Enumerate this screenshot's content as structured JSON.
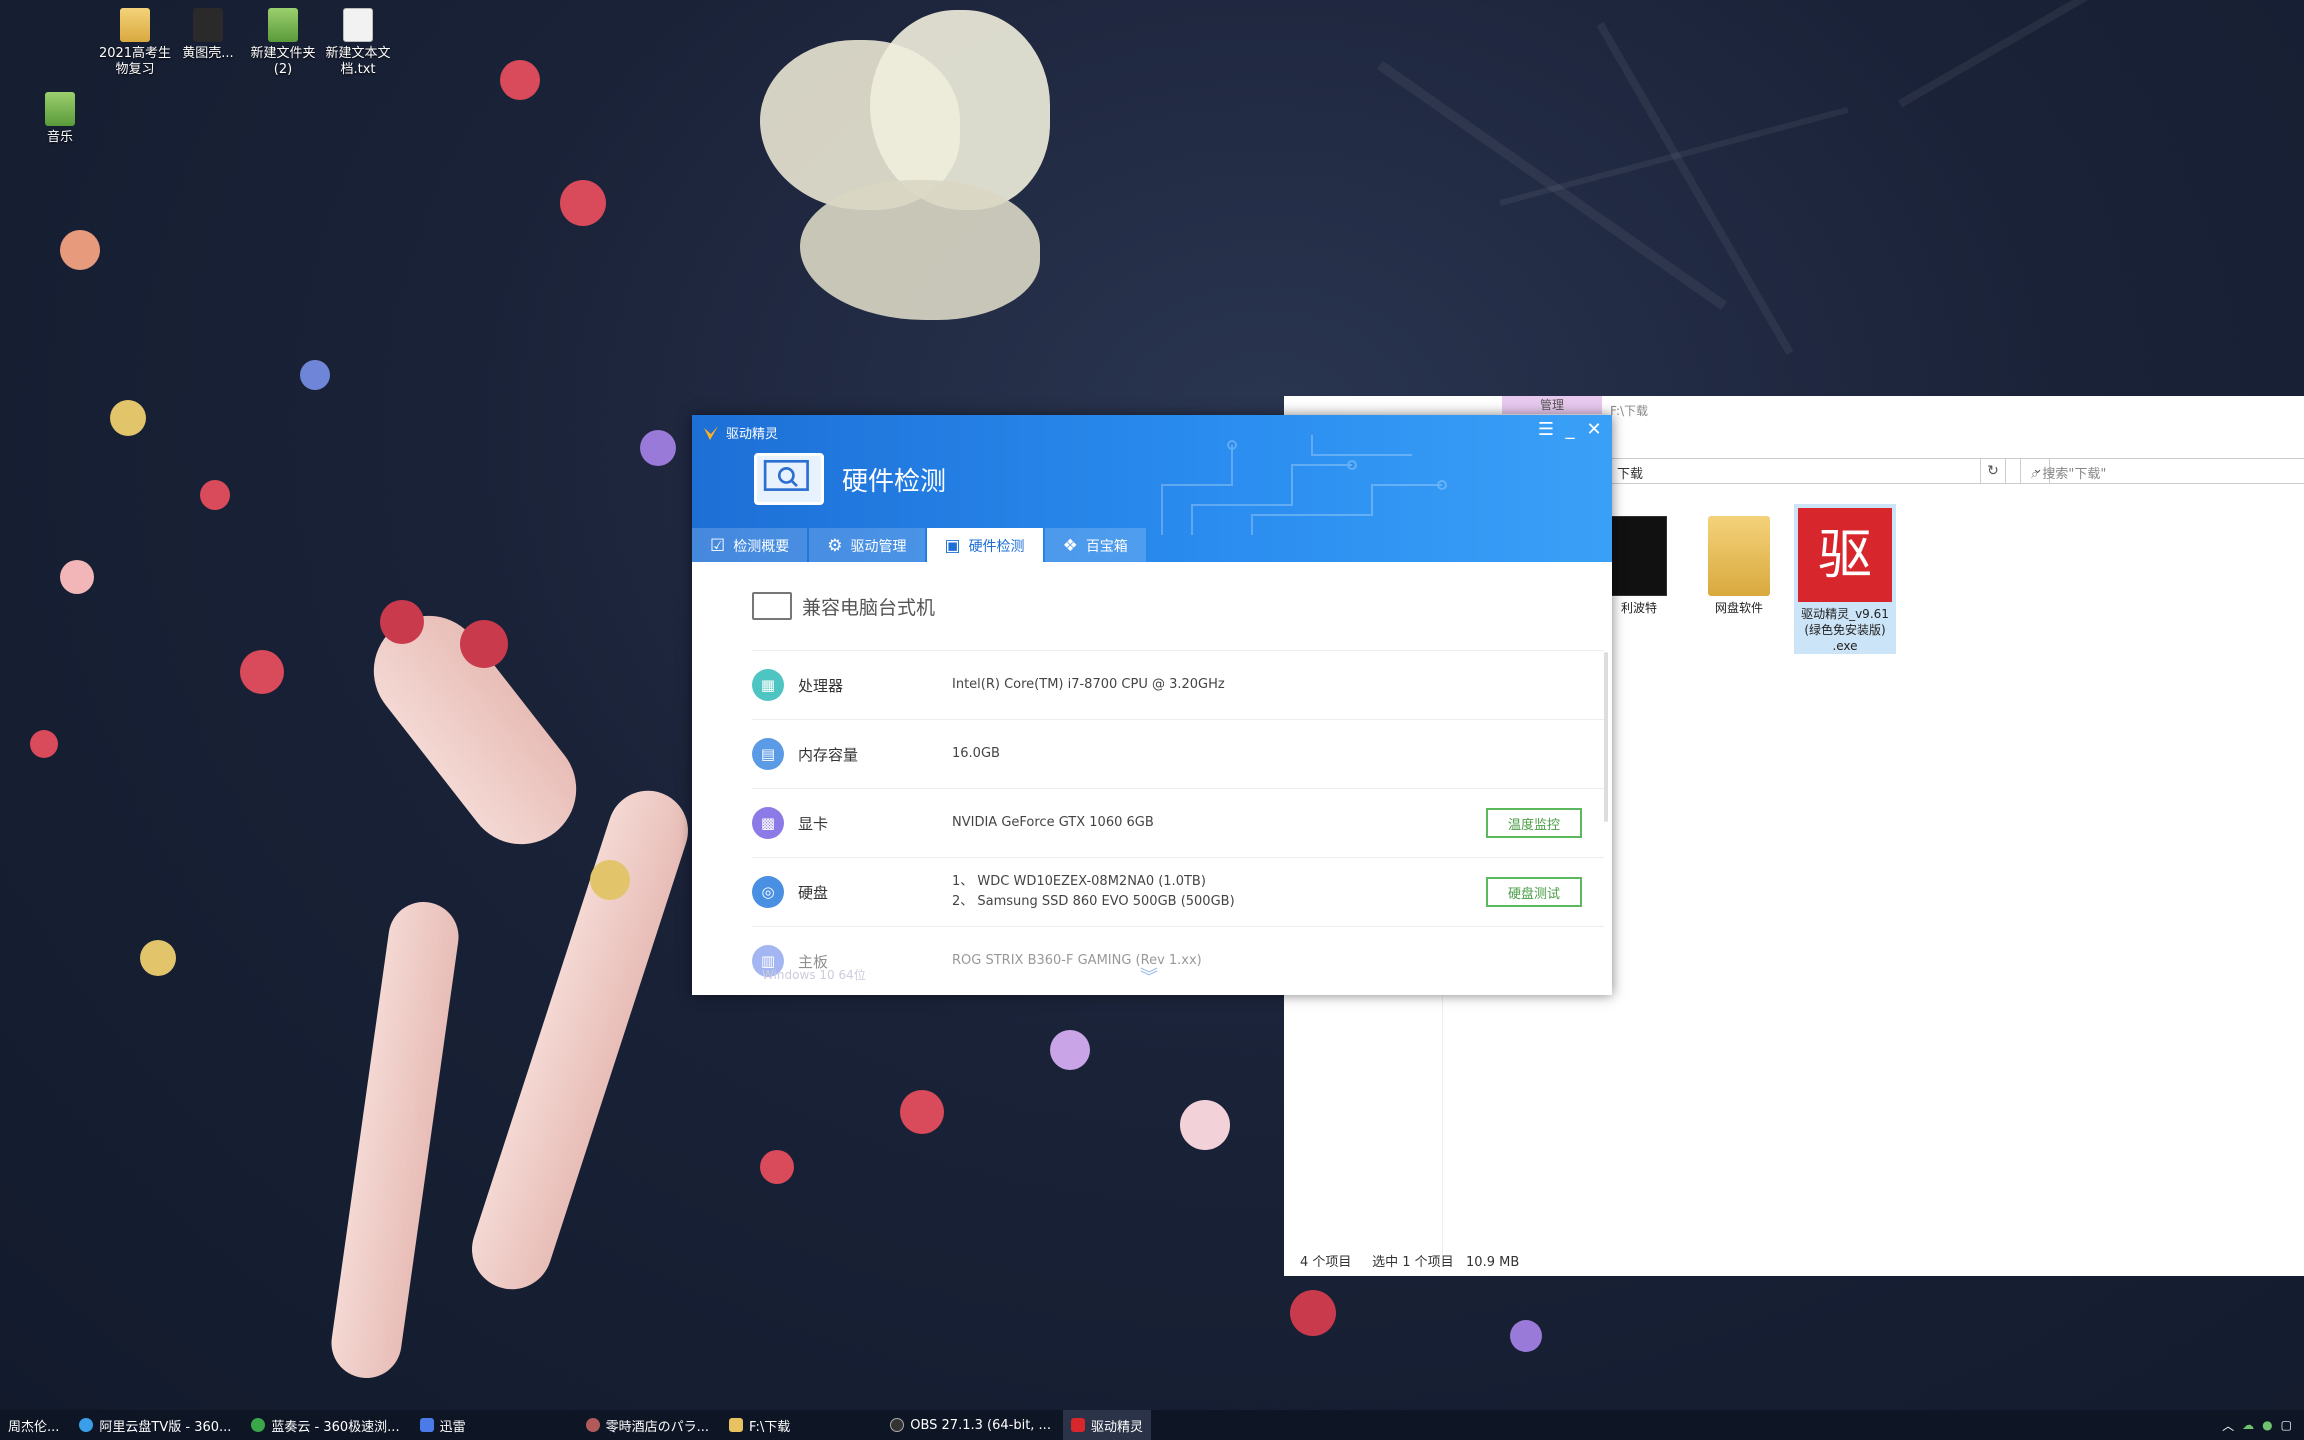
{
  "desktop": {
    "icons": [
      {
        "label": "2021高考生物复习"
      },
      {
        "label": "黄图壳..."
      },
      {
        "label": "新建文件夹 (2)"
      },
      {
        "label": "新建文本文档.txt"
      },
      {
        "label": "音乐"
      }
    ]
  },
  "explorer": {
    "manage_tab": "管理",
    "path_title": "F:\\下载",
    "address": "下载",
    "search_placeholder": "搜索\"下载\"",
    "files": [
      {
        "label": "利波特"
      },
      {
        "label": "网盘软件"
      },
      {
        "label": "驱动精灵_v9.61 (绿色免安装版) .exe"
      }
    ],
    "status": {
      "item_count": "4 个项目",
      "selected": "选中 1 个项目",
      "size": "10.9 MB"
    }
  },
  "app": {
    "name": "驱动精灵",
    "header_title": "硬件检测",
    "tabs": [
      {
        "label": "检测概要",
        "icon": "check-icon"
      },
      {
        "label": "驱动管理",
        "icon": "gear-icon"
      },
      {
        "label": "硬件检测",
        "icon": "monitor-icon"
      },
      {
        "label": "百宝箱",
        "icon": "toolbox-icon"
      }
    ],
    "pc_type": "兼容电脑台式机",
    "rows": [
      {
        "label": "处理器",
        "value": "Intel(R) Core(TM) i7-8700 CPU @ 3.20GHz",
        "color": "#4ec5c2",
        "icon": "cpu-icon"
      },
      {
        "label": "内存容量",
        "value": "16.0GB",
        "color": "#5b9be6",
        "icon": "memory-icon"
      },
      {
        "label": "显卡",
        "value": "NVIDIA GeForce GTX 1060 6GB",
        "color": "#8c7ae6",
        "icon": "gpu-icon",
        "button": "温度监控"
      },
      {
        "label": "硬盘",
        "value_lines": [
          "1、 WDC WD10EZEX-08M2NA0 (1.0TB)",
          "2、 Samsung SSD 860 EVO 500GB (500GB)"
        ],
        "color": "#4a90e2",
        "icon": "disk-icon",
        "button": "硬盘测试"
      },
      {
        "label": "主板",
        "value": "ROG STRIX B360-F GAMING (Rev 1.xx)",
        "color": "#5b7be6",
        "icon": "motherboard-icon"
      }
    ],
    "footer_os": "Windows 10 64位"
  },
  "taskbar": {
    "items": [
      {
        "label": "周杰伦..."
      },
      {
        "label": "阿里云盘TV版 - 360..."
      },
      {
        "label": "蓝奏云 - 360极速浏..."
      },
      {
        "label": "迅雷"
      },
      {
        "label": "零時酒店のパラ..."
      },
      {
        "label": "F:\\下载"
      },
      {
        "label": "OBS 27.1.3 (64-bit, ..."
      },
      {
        "label": "驱动精灵"
      }
    ]
  }
}
